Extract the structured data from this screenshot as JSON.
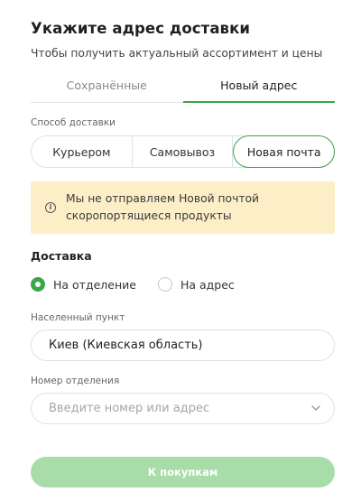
{
  "header": {
    "title": "Укажите адрес доставки",
    "subtitle": "Чтобы получить актуальный ассортимент и цены"
  },
  "tabs": [
    {
      "label": "Сохранённые",
      "active": false
    },
    {
      "label": "Новый адрес",
      "active": true
    }
  ],
  "delivery_method": {
    "label": "Способ доставки",
    "options": [
      {
        "label": "Курьером",
        "selected": false
      },
      {
        "label": "Самовывоз",
        "selected": false
      },
      {
        "label": "Новая почта",
        "selected": true
      }
    ]
  },
  "notice": {
    "icon": "info-icon",
    "line1": "Мы не отправляем Новой почтой",
    "line2": "скоропортящиеся продукты",
    "background": "#fcefc7"
  },
  "delivery": {
    "heading": "Доставка",
    "options": [
      {
        "label": "На отделение",
        "checked": true
      },
      {
        "label": "На адрес",
        "checked": false
      }
    ]
  },
  "city": {
    "label": "Населенный пункт",
    "value": "Киев (Киевская область)"
  },
  "branch": {
    "label": "Номер отделения",
    "placeholder": "Введите номер или адрес"
  },
  "cta": {
    "label": "К покупкам",
    "color": "#a8dda9"
  },
  "accent_color": "#3aa64a"
}
